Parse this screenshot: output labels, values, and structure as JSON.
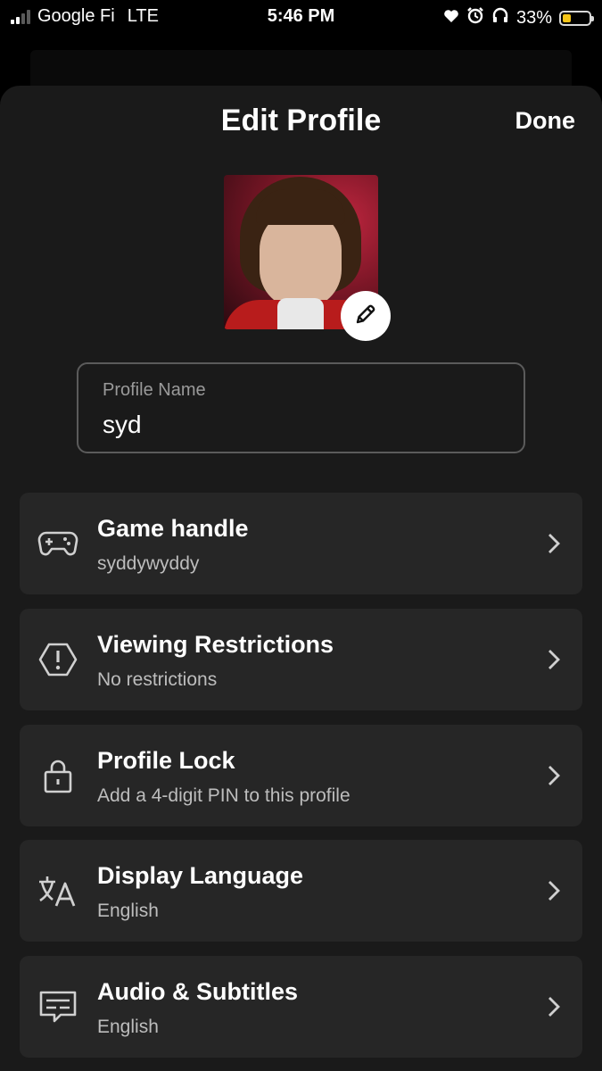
{
  "status_bar": {
    "carrier": "Google Fi",
    "network": "LTE",
    "time": "5:46 PM",
    "battery_text": "33%",
    "battery_level": 0.33,
    "icons": [
      "signal-icon",
      "heart-icon",
      "alarm-icon",
      "headphones-icon",
      "battery-icon"
    ]
  },
  "header": {
    "title": "Edit Profile",
    "done_label": "Done"
  },
  "avatar": {
    "edit_icon": "pencil-icon"
  },
  "profile_name": {
    "label": "Profile Name",
    "value": "syd"
  },
  "settings": [
    {
      "title": "Game handle",
      "subtitle": "syddywyddy",
      "icon": "gamepad-icon"
    },
    {
      "title": "Viewing Restrictions",
      "subtitle": "No restrictions",
      "icon": "warning-hexagon-icon"
    },
    {
      "title": "Profile Lock",
      "subtitle": "Add a 4-digit PIN to this profile",
      "icon": "lock-icon"
    },
    {
      "title": "Display Language",
      "subtitle": "English",
      "icon": "translate-icon"
    },
    {
      "title": "Audio & Subtitles",
      "subtitle": "English",
      "icon": "subtitles-icon"
    }
  ],
  "colors": {
    "background": "#000000",
    "sheet": "#1a1a1a",
    "row": "#262626",
    "battery_fill": "#f5c518"
  }
}
